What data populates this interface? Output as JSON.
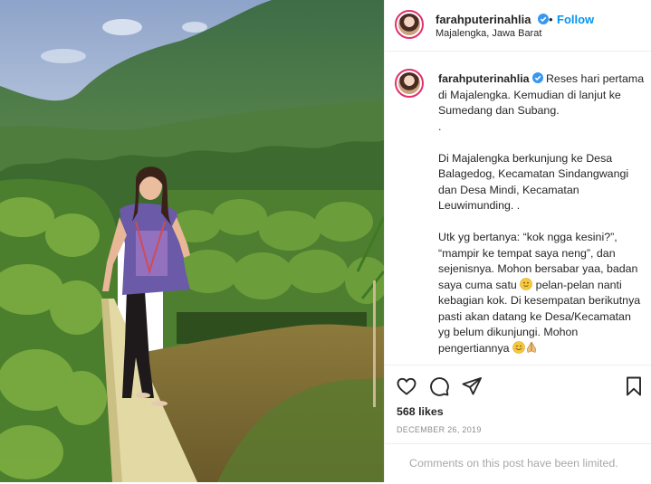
{
  "post": {
    "username": "farahputerinahlia",
    "follow_label": "Follow",
    "separator": "•",
    "location": "Majalengka, Jawa Barat",
    "photo_icon": "photo-image"
  },
  "caption": {
    "username": "farahputerinahlia",
    "text": "Reses hari pertama di Majalengka. Kemudian di lanjut ke Sumedang dan Subang.\n.\n\nDi Majalengka berkunjung ke Desa Balagedog, Kecamatan Sindangwangi dan Desa Mindi, Kecamatan Leuwimunding. .\n\nUtk yg bertanya: “kok ngga kesini?”, “mampir ke tempat saya neng”, dan sejenisnya. Mohon bersabar yaa, badan saya cuma satu",
    "text_2": " pelan-pelan nanti kebagian kok. Di kesempatan berikutnya pasti akan datang ke Desa/Kecamatan yg belum dikunjungi. Mohon pengertiannya ",
    "emoji_1": "slightly-smiling-face",
    "emoji_2": "smiling-face",
    "emoji_3": "folded-hands"
  },
  "actions": {
    "like_icon": "heart-icon",
    "comment_icon": "comment-icon",
    "share_icon": "paper-plane-icon",
    "save_icon": "bookmark-icon",
    "likes": "568 likes",
    "date": "DECEMBER 26, 2019",
    "comments_limited": "Comments on this post have been limited."
  },
  "colors": {
    "accent": "#0095f6",
    "muted": "#8e8e8e",
    "border": "#efefef",
    "verified": "#3897f0"
  }
}
